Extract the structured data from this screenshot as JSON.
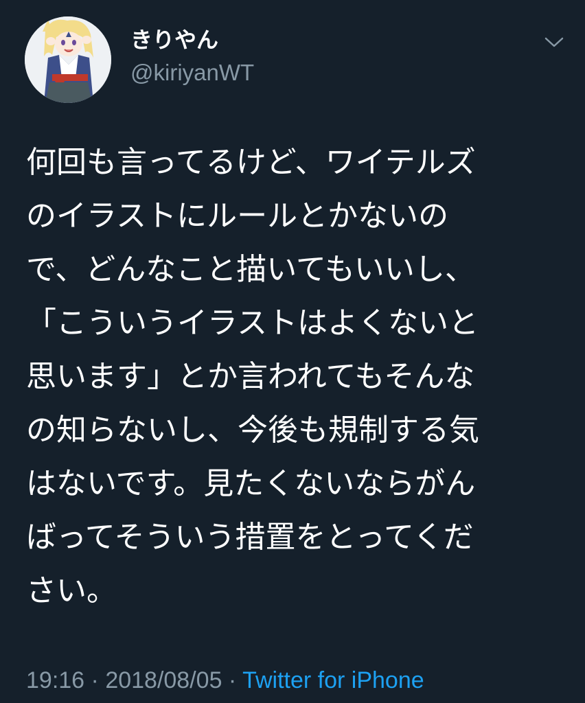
{
  "user": {
    "display_name": "きりやん",
    "handle": "@kiriyanWT",
    "avatar_icon": "avatar-anime-character-icon"
  },
  "menu": {
    "icon": "chevron-down-icon"
  },
  "tweet": {
    "lines": [
      "何回も言ってるけど、ワイテルズ",
      "のイラストにルールとかないの",
      "で、どんなこと描いてもいいし、",
      "「こういうイラストはよくないと",
      "思います」とか言われてもそんな",
      "の知らないし、今後も規制する気",
      "はないです。見たくないならがん",
      "ばってそういう措置をとってくだ",
      "さい。"
    ]
  },
  "meta": {
    "time": "19:16",
    "separator1": " · ",
    "date": "2018/08/05",
    "separator2": " · ",
    "source": "Twitter for iPhone"
  },
  "colors": {
    "background": "#15202b",
    "text": "#ffffff",
    "secondary": "#8899a6",
    "link": "#1da1f2"
  }
}
